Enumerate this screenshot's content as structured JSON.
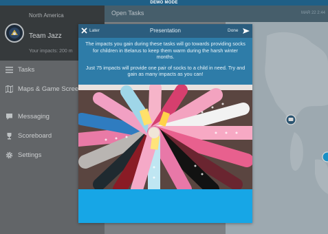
{
  "demo_banner": "DEMO MODE",
  "sidebar": {
    "region": "North America",
    "team_name": "Team Jazz",
    "impacts_text": "Your impacts: 200 m",
    "nav_items": [
      {
        "label": "Tasks",
        "icon": "list-icon"
      },
      {
        "label": "Maps & Game Screens",
        "icon": "map-icon"
      },
      {
        "label": "Messaging",
        "icon": "chat-bubble-icon"
      },
      {
        "label": "Scoreboard",
        "icon": "trophy-icon"
      },
      {
        "label": "Settings",
        "icon": "gear-icon"
      }
    ]
  },
  "main": {
    "title": "Open Tasks",
    "date": "MAR 22 2:44"
  },
  "modal": {
    "later_label": "Later",
    "title": "Presentation",
    "done_label": "Done",
    "paragraph1": "The impacts you gain during these tasks will go towards providing socks for children in Belarus to keep them warm during the harsh winter months.",
    "paragraph2": "Just 75 impacts will provide one pair of socks to a child in need. Try and gain as many impacts as you can!"
  },
  "colors": {
    "demo_bar": "#1f5f86",
    "sidebar": "#707274",
    "team_header": "#3a3d3f",
    "modal_header": "#2b5d7e",
    "modal_text_bg": "#2e7ca8",
    "modal_bg": "#17a6e6"
  }
}
